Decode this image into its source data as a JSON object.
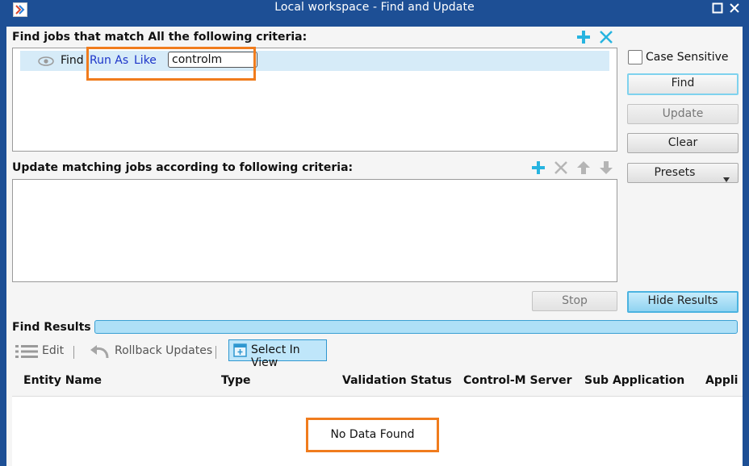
{
  "window": {
    "title": "Local workspace - Find and Update",
    "maximize_icon": "maximize-icon",
    "close_icon": "close-icon"
  },
  "find_section": {
    "heading": "Find jobs that match All the following criteria:",
    "criteria": [
      {
        "prefix": "Find",
        "field": "Run As",
        "operator": "Like",
        "value": "controlm"
      }
    ]
  },
  "update_section": {
    "heading": "Update matching jobs according to following criteria:"
  },
  "side_panel": {
    "case_sensitive_label": "Case Sensitive",
    "case_sensitive_checked": false,
    "find_label": "Find",
    "update_label": "Update",
    "clear_label": "Clear",
    "presets_label": "Presets"
  },
  "actions": {
    "stop_label": "Stop",
    "hide_results_label": "Hide Results"
  },
  "results": {
    "heading": "Find Results",
    "toolbar": {
      "edit_label": "Edit",
      "rollback_label": "Rollback Updates",
      "select_in_view_label": "Select In View"
    },
    "columns": [
      "Entity Name",
      "Type",
      "Validation Status",
      "Control-M Server",
      "Sub Application",
      "Appli"
    ],
    "empty_message": "No Data Found"
  },
  "colors": {
    "titlebar": "#1d4f95",
    "accent_blue": "#27b4e0",
    "highlight_orange": "#f07c1d",
    "selected_row": "#d6ebf8"
  }
}
